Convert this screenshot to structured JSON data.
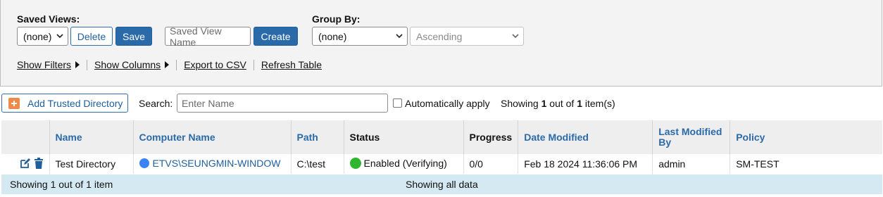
{
  "saved_views": {
    "label": "Saved Views:",
    "select_value": "(none)",
    "delete_label": "Delete",
    "save_label": "Save",
    "name_placeholder": "Saved View Name",
    "create_label": "Create"
  },
  "group_by": {
    "label": "Group By:",
    "select_value": "(none)",
    "order_value": "Ascending"
  },
  "links": {
    "show_filters": "Show Filters",
    "show_columns": "Show Columns",
    "export_csv": "Export to CSV",
    "refresh_table": "Refresh Table"
  },
  "search_bar": {
    "add_label": "Add Trusted Directory",
    "search_label": "Search:",
    "search_placeholder": "Enter Name",
    "auto_apply_label": "Automatically apply",
    "showing_prefix": "Showing",
    "showing_count": "1",
    "showing_mid": "out of",
    "showing_total": "1",
    "showing_suffix": "item(s)"
  },
  "table": {
    "headers": {
      "name": "Name",
      "computer_name": "Computer Name",
      "path": "Path",
      "status": "Status",
      "progress": "Progress",
      "date_modified": "Date Modified",
      "last_modified_by": "Last Modified By",
      "policy": "Policy"
    },
    "rows": [
      {
        "name": "Test Directory",
        "computer_name": "ETVS\\SEUNGMIN-WINDOW",
        "path": "C:\\test",
        "status": "Enabled (Verifying)",
        "progress": "0/0",
        "date_modified": "Feb 18 2024 11:36:06 PM",
        "last_modified_by": "admin",
        "policy": "SM-TEST"
      }
    ]
  },
  "footer": {
    "left": "Showing 1 out of 1 item",
    "center": "Showing all data"
  },
  "colors": {
    "accent": "#2b6aa8",
    "add_icon": "#f08a4b",
    "status_enabled": "#2fb52f",
    "computer_icon": "#3b82f6",
    "footer_bg": "#d4e9f2"
  }
}
